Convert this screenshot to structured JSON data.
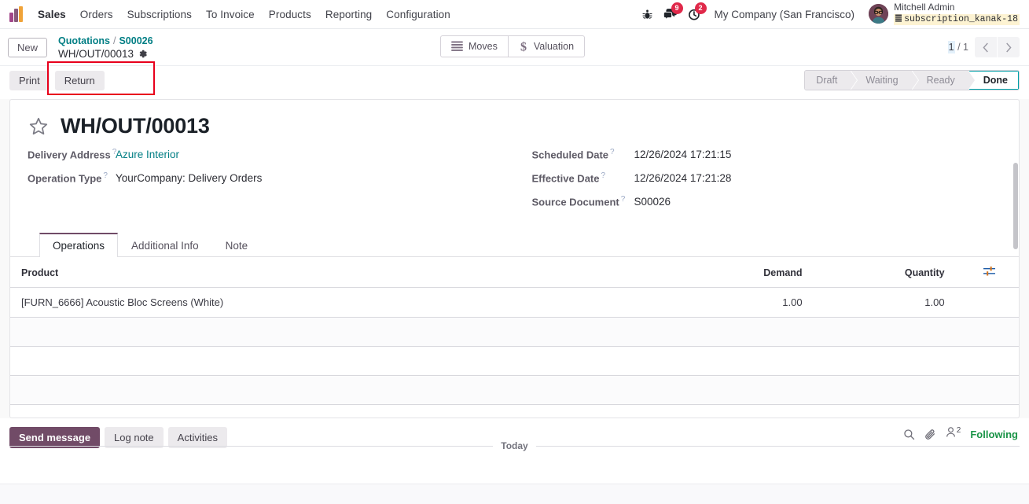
{
  "navbar": {
    "brand_icon": "odoo-logo",
    "app_name": "Sales",
    "menus": [
      "Orders",
      "Subscriptions",
      "To Invoice",
      "Products",
      "Reporting",
      "Configuration"
    ],
    "debug_icon": "bug-icon",
    "messages_icon": "chat-bubble-icon",
    "messages_count": "9",
    "activities_icon": "clock-icon",
    "activities_count": "2",
    "company": "My Company (San Francisco)",
    "user_name": "Mitchell Admin",
    "user_db": "subscription_kanak-18",
    "db_icon": "database-icon"
  },
  "control_panel": {
    "new_label": "New",
    "breadcrumb_root": "Quotations",
    "breadcrumb_separator": "/",
    "breadcrumb_parent": "S00026",
    "breadcrumb_current": "WH/OUT/00013",
    "settings_icon": "gear-icon",
    "stat_buttons": [
      {
        "label": "Moves",
        "icon": "list-icon"
      },
      {
        "label": "Valuation",
        "icon": "dollar-icon"
      }
    ],
    "pager_current": "1",
    "pager_sep": "/",
    "pager_total": "1",
    "prev_icon": "chevron-left-icon",
    "next_icon": "chevron-right-icon",
    "highlight_color": "#e8001c"
  },
  "actions": {
    "print_label": "Print",
    "return_label": "Return"
  },
  "statusbar": {
    "states": [
      "Draft",
      "Waiting",
      "Ready",
      "Done"
    ],
    "active": "Done",
    "active_color": "#00a0a8"
  },
  "record": {
    "favorite_icon": "star-icon",
    "title": "WH/OUT/00013",
    "fields_left": [
      {
        "label": "Delivery Address",
        "value": "Azure Interior",
        "is_link": true
      },
      {
        "label": "Operation Type",
        "value": "YourCompany: Delivery Orders",
        "is_link": false
      }
    ],
    "fields_right": [
      {
        "label": "Scheduled Date",
        "value": "12/26/2024 17:21:15"
      },
      {
        "label": "Effective Date",
        "value": "12/26/2024 17:21:28"
      },
      {
        "label": "Source Document",
        "value": "S00026"
      }
    ],
    "tooltip_marker": "?"
  },
  "notebook": {
    "tabs": [
      "Operations",
      "Additional Info",
      "Note"
    ],
    "active_tab": "Operations",
    "table": {
      "columns": [
        "Product",
        "Demand",
        "Quantity"
      ],
      "optional_columns_icon": "sliders-icon",
      "rows": [
        {
          "product": "[FURN_6666] Acoustic Bloc Screens (White)",
          "demand": "1.00",
          "quantity": "1.00"
        }
      ],
      "empty_rows": 4
    }
  },
  "chatter": {
    "send_message_label": "Send message",
    "log_note_label": "Log note",
    "activities_label": "Activities",
    "search_icon": "search-icon",
    "attachment_icon": "paperclip-icon",
    "followers_icon": "user-icon",
    "followers_count": "2",
    "following_label": "Following",
    "following_color": "#1a9447",
    "date_separator": "Today"
  }
}
